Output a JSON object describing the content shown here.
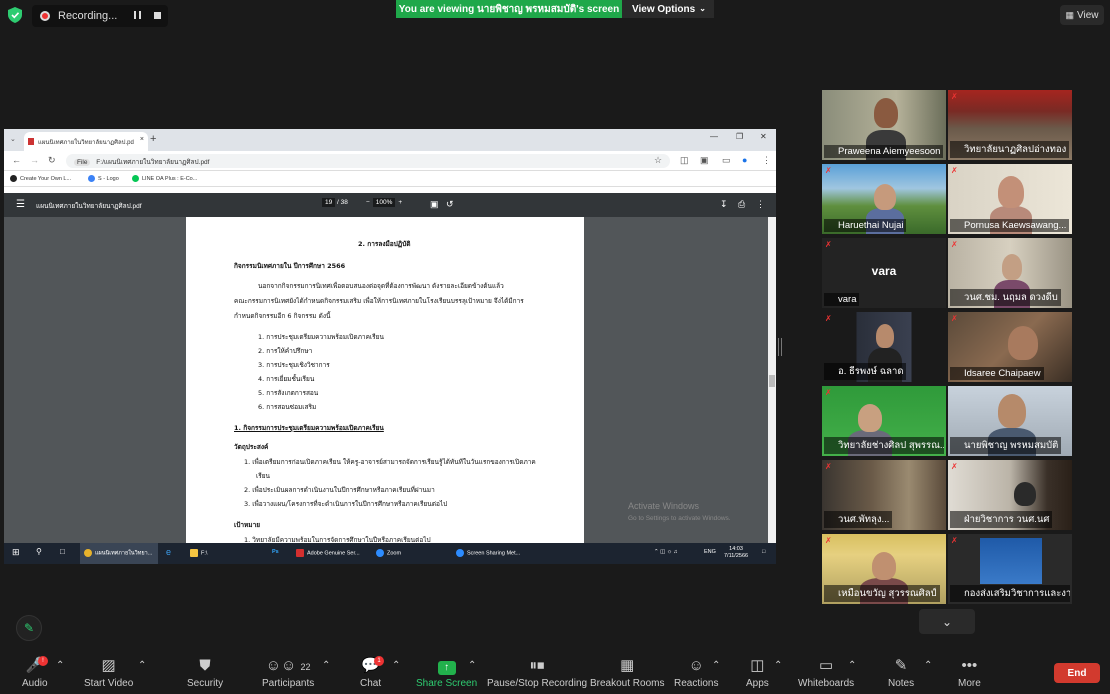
{
  "top": {
    "recording_label": "Recording...",
    "viewing_banner": "You are viewing นายพิชาญ พรหมสมบัติ's screen",
    "view_options": "View Options",
    "view_button": "View"
  },
  "browser": {
    "tab_title": "แผนนิเทศภายในวิทยาลัยนาฏศิลป.pd",
    "address_scheme": "File",
    "address": "F:/แผนนิเทศภายในวิทยาลัยนาฏศิลป.pdf",
    "bookmarks": [
      "Create Your Own L...",
      "S - Logo",
      "LINE OA Plus : E-Co..."
    ]
  },
  "pdf": {
    "title": "แผนนิเทศภายในวิทยาลัยนาฏศิลป.pdf",
    "page_current": "19",
    "page_total": "/ 38",
    "zoom": "100%",
    "lines": [
      "2. การลงมือปฏิบัติ",
      "กิจกรรมนิเทศภายใน  ปีการศึกษา 2566",
      "นอกจากกิจกรรมการนิเทศเพื่อตอบสนองต่อจุดที่ต้องการพัฒนา  ดังรายละเอียดข้างต้นแล้ว",
      "คณะกรรมการนิเทศยังได้กำหนดกิจกรรมเสริม เพื่อให้การนิเทศภายในโรงเรียนบรรลุเป้าหมาย จึงได้มีการ",
      "กำหนดกิจกรรมอีก 6 กิจกรรม ดังนี้",
      "1. การประชุมเตรียมความพร้อมเปิดภาคเรียน",
      "2. การให้คำปรึกษา",
      "3. การประชุมเชิงวิชาการ",
      "4. การเยี่ยมชั้นเรียน",
      "5. การสังเกตการสอน",
      "6. การสอนซ่อมเสริม",
      "1. กิจกรรมการประชุมเตรียมความพร้อมเปิดภาคเรียน",
      "วัตถุประสงค์",
      "1. เพื่อเตรียมการก่อนเปิดภาคเรียน ให้ครู-อาจารย์สามารถจัดการเรียนรู้ได้ทันทีในวันแรกของการเปิดภาค",
      "เรียน",
      "2. เพื่อประเมินผลการดำเนินงานในปีการศึกษาหรือภาคเรียนที่ผ่านมา",
      "3. เพื่อวางแผน/โครงการที่จะดำเนินการในปีการศึกษาหรือภาคเรียนต่อไป",
      "เป้าหมาย",
      "1. วิทยาลัยมีความพร้อมในการจัดการศึกษาในปีหรือภาคเรียนต่อไป"
    ],
    "activate_title": "Activate Windows",
    "activate_sub": "Go to Settings to activate Windows."
  },
  "taskbar": {
    "items": [
      "แผนนิเทศภายในวิทยา...",
      "F:\\",
      "Adobe Genuine Ser...",
      "Zoom",
      "Screen Sharing Met..."
    ],
    "lang": "ENG",
    "time": "14:03",
    "date": "7/11/2566"
  },
  "gallery": [
    {
      "name": "Praweena Aiemyeesoon"
    },
    {
      "name": "วิทยาลัยนาฏศิลปอ่างทอง"
    },
    {
      "name": "Haruethai Nujai"
    },
    {
      "name": "Pornusa Kaewsawang..."
    },
    {
      "name": "vara",
      "center": "vara"
    },
    {
      "name": "วนศ.ชม. นฤมล ดวงดีบ"
    },
    {
      "name": "อ. ธีรพงษ์  ฉลาด"
    },
    {
      "name": "Idsaree Chaipaew"
    },
    {
      "name": "วิทยาลัยช่างศิลป สุพรรณ..."
    },
    {
      "name": "นายพิชาญ พรหมสมบัติ"
    },
    {
      "name": "วนศ.พัทลุง..."
    },
    {
      "name": "ฝ่ายวิชาการ วนศ.นศ"
    },
    {
      "name": "เหมือนขวัญ สุวรรณศิลป์"
    },
    {
      "name": "กองส่งเสริมวิชาการและงานวิจัย"
    }
  ],
  "toolbar": {
    "audio": "Audio",
    "video": "Start Video",
    "security": "Security",
    "participants": "Participants",
    "participants_count": "22",
    "chat": "Chat",
    "chat_badge": "1",
    "audio_badge": "!",
    "share": "Share Screen",
    "recording": "Pause/Stop Recording",
    "breakout": "Breakout Rooms",
    "reactions": "Reactions",
    "apps": "Apps",
    "whiteboards": "Whiteboards",
    "notes": "Notes",
    "more": "More",
    "end": "End"
  }
}
